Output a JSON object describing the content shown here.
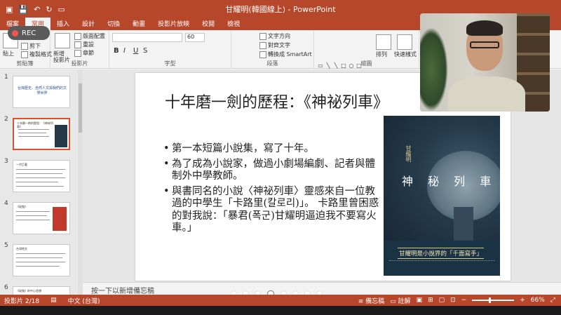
{
  "window": {
    "title": "甘耀明(韓國線上) - PowerPoint"
  },
  "colors": {
    "accent": "#b7472a",
    "selected_thumb": "#d35230"
  },
  "ribbon_tabs": [
    {
      "label": "檔案",
      "active": false
    },
    {
      "label": "常用",
      "active": true
    },
    {
      "label": "插入",
      "active": false
    },
    {
      "label": "設計",
      "active": false
    },
    {
      "label": "切換",
      "active": false
    },
    {
      "label": "動畫",
      "active": false
    },
    {
      "label": "投影片放映",
      "active": false
    },
    {
      "label": "校閱",
      "active": false
    },
    {
      "label": "檢視",
      "active": false
    }
  ],
  "ribbon": {
    "paste": "貼上",
    "cut": "剪下",
    "copy": "複製",
    "format_painter": "複製格式",
    "clipboard_group": "剪貼簿",
    "new_slide": "新增\n投影片",
    "layout": "版面配置",
    "reset": "重設",
    "section": "章節",
    "slides_group": "投影片",
    "font_size": "60",
    "font_group": "字型",
    "text_direction": "文字方向",
    "align_text": "對齊文字",
    "smartart": "轉換成 SmartArt",
    "paragraph_group": "段落",
    "arrange": "排列",
    "quick_styles": "快速樣式",
    "drawing_group": "繪圖",
    "bold": "B",
    "italic": "I",
    "underline": "U",
    "strike": "S"
  },
  "rec_button": "REC",
  "thumbnails": [
    {
      "num": "1",
      "text": "台灣歷史、自然人文與我們的文學世界"
    },
    {
      "num": "2",
      "text": "十年磨一劍的歷程：《神祕列車》"
    },
    {
      "num": "3",
      "text": "一代巨著"
    },
    {
      "num": "4",
      "text": "《殺鬼》"
    },
    {
      "num": "5",
      "text": "台灣地文"
    },
    {
      "num": "6",
      "text": "《殺鬼》的中心思想"
    }
  ],
  "slide": {
    "title": "十年磨一劍的歷程：《神祕列車》",
    "bullets": [
      "第一本短篇小說集，寫了十年。",
      "為了成為小說家，做過小劇場編劇、記者與體制外中學教師。",
      "與書同名的小說〈神祕列車〉靈感來自一位教過的中學生「卡路里(칼로리)」。 卡路里曾困惑的對我說：「暴君(폭군)甘耀明逼迫我不要寫火車。」"
    ],
    "book": {
      "title": "神 秘 列 車",
      "author": "甘耀明",
      "tagline": "甘耀明是小說界的「千面寫手」"
    }
  },
  "notes_placeholder": "按一下以新增備忘稿",
  "status": {
    "slide_counter": "投影片 2/18",
    "language": "中文 (台灣)",
    "notes_button": "備忘稿",
    "comments_button": "註解",
    "zoom": "66%"
  }
}
